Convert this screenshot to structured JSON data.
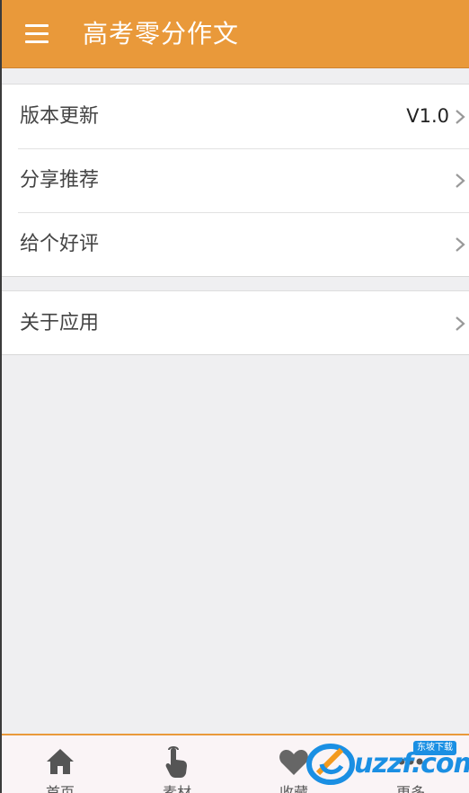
{
  "topbar": {
    "title": "高考零分作文",
    "menu_icon": "hamburger-menu-icon",
    "background": "#e9993a"
  },
  "settings": {
    "group1": [
      {
        "label": "版本更新",
        "value": "V1.0"
      },
      {
        "label": "分享推荐",
        "value": ""
      },
      {
        "label": "给个好评",
        "value": ""
      }
    ],
    "group2": [
      {
        "label": "关于应用",
        "value": ""
      }
    ]
  },
  "bottom_nav": {
    "items": [
      {
        "label": "首页",
        "icon": "home-icon"
      },
      {
        "label": "素材",
        "icon": "hand-pointer-icon"
      },
      {
        "label": "收藏",
        "icon": "heart-icon"
      },
      {
        "label": "更多",
        "icon": "more-icon"
      }
    ],
    "accent": "#e9993a"
  },
  "watermark": {
    "text": "uzzf.com",
    "badge": "东坡下载"
  }
}
